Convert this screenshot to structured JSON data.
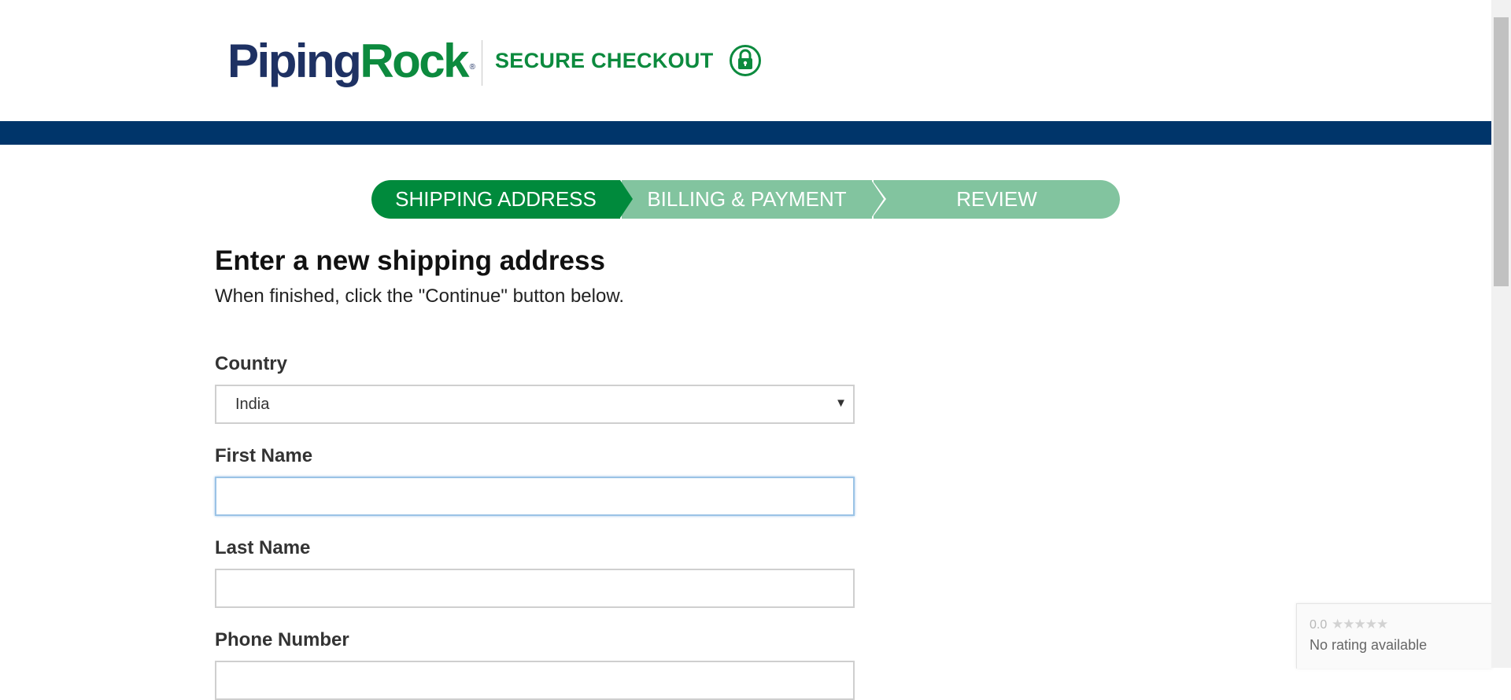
{
  "header": {
    "logo_part1": "Piping",
    "logo_part2": "Rock",
    "logo_reg": "®",
    "secure_label": "SECURE CHECKOUT",
    "lock_icon": "lock-icon"
  },
  "colors": {
    "brand_navy": "#1e3163",
    "brand_green": "#0c8a3e",
    "band_blue": "#00356a",
    "step_active": "#008a3c",
    "step_inactive": "#82c49f"
  },
  "stepper": {
    "steps": [
      {
        "label": "SHIPPING ADDRESS",
        "active": true
      },
      {
        "label": "BILLING & PAYMENT",
        "active": false
      },
      {
        "label": "REVIEW",
        "active": false
      }
    ]
  },
  "form": {
    "title": "Enter a new shipping address",
    "subtitle": "When finished, click the \"Continue\" button below.",
    "country_label": "Country",
    "country_value": "India",
    "first_name_label": "First Name",
    "first_name_value": "",
    "last_name_label": "Last Name",
    "last_name_value": "",
    "phone_label": "Phone Number"
  },
  "rating": {
    "score": "0.0",
    "stars": "★★★★★",
    "text": "No rating available"
  }
}
